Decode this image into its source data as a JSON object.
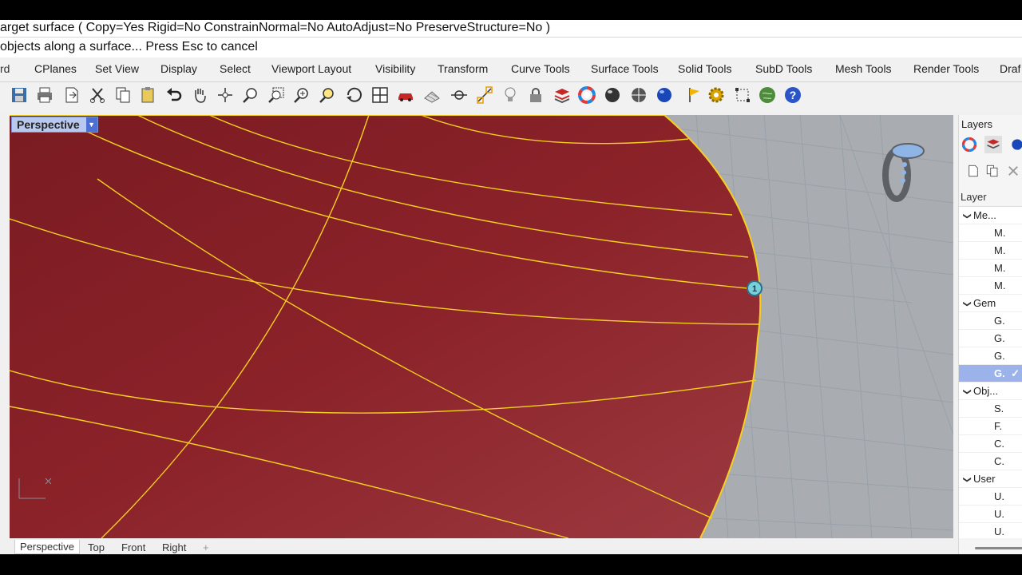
{
  "command": {
    "line1": "arget surface ( Copy=Yes  Rigid=No  ConstrainNormal=No  AutoAdjust=No  PreserveStructure=No )",
    "line2": " objects along a surface... Press Esc to cancel"
  },
  "tabs": [
    {
      "label": "rd",
      "active": true
    },
    {
      "label": "CPlanes"
    },
    {
      "label": "Set View"
    },
    {
      "label": "Display"
    },
    {
      "label": "Select"
    },
    {
      "label": "Viewport Layout"
    },
    {
      "label": "Visibility"
    },
    {
      "label": "Transform"
    },
    {
      "label": "Curve Tools"
    },
    {
      "label": "Surface Tools"
    },
    {
      "label": "Solid Tools"
    },
    {
      "label": "SubD Tools"
    },
    {
      "label": "Mesh Tools"
    },
    {
      "label": "Render Tools"
    },
    {
      "label": "Draf"
    }
  ],
  "toolbar_icons": [
    "save-icon",
    "print-icon",
    "import-icon",
    "cut-icon",
    "copy-icon",
    "paste-icon",
    "undo-icon",
    "pan-hand-icon",
    "rotate-view-icon",
    "zoom-dynamic-icon",
    "zoom-window-icon",
    "zoom-extents-icon",
    "zoom-selected-icon",
    "rotate-camera-icon",
    "four-views-icon",
    "car-icon",
    "grid-icon",
    "snap-icon",
    "osnap-icon",
    "lightbulb-icon",
    "lock-icon",
    "layer-icon",
    "color-wheel-icon",
    "render-sphere-icon",
    "shaded-sphere-icon",
    "blue-sphere-icon",
    "flag-icon",
    "gear-icon",
    "bounding-box-icon",
    "globe-icon",
    "help-icon"
  ],
  "viewport": {
    "label": "Perspective",
    "marker_label": "1"
  },
  "viewport_tabs": [
    {
      "label": "Perspective",
      "active": true
    },
    {
      "label": "Top"
    },
    {
      "label": "Front"
    },
    {
      "label": "Right"
    },
    {
      "label": "+"
    }
  ],
  "layers_panel": {
    "title": "Layers",
    "column_header": "Layer",
    "rows": [
      {
        "label": "Me...",
        "type": "group"
      },
      {
        "label": "M.",
        "type": "child"
      },
      {
        "label": "M.",
        "type": "child"
      },
      {
        "label": "M.",
        "type": "child"
      },
      {
        "label": "M.",
        "type": "child"
      },
      {
        "label": "Gem",
        "type": "group"
      },
      {
        "label": "G.",
        "type": "child"
      },
      {
        "label": "G.",
        "type": "child"
      },
      {
        "label": "G.",
        "type": "child"
      },
      {
        "label": "G.",
        "type": "child",
        "selected": true,
        "check": "✓"
      },
      {
        "label": "Obj...",
        "type": "group"
      },
      {
        "label": "S.",
        "type": "child"
      },
      {
        "label": "F.",
        "type": "child"
      },
      {
        "label": "C.",
        "type": "child"
      },
      {
        "label": "C.",
        "type": "child"
      },
      {
        "label": "User",
        "type": "group"
      },
      {
        "label": "U.",
        "type": "child"
      },
      {
        "label": "U.",
        "type": "child"
      },
      {
        "label": "U.",
        "type": "child"
      }
    ]
  },
  "colors": {
    "surface": "#8f2a30",
    "curve": "#f5d020",
    "viewport_bg": "#a9adb2",
    "selection": "#9bb3ea"
  }
}
